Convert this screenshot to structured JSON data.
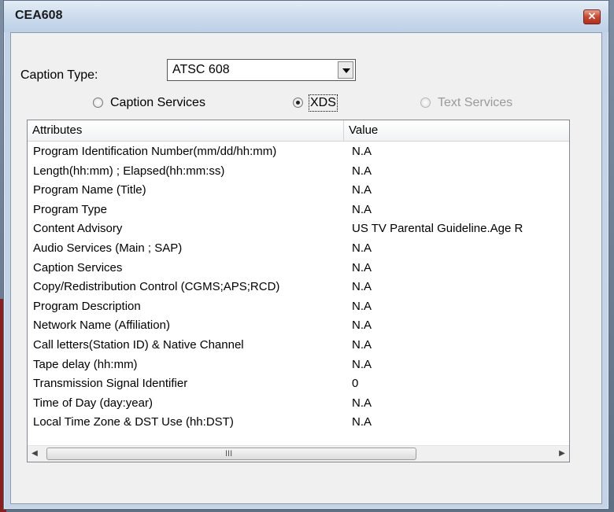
{
  "window": {
    "title": "CEA608",
    "close_glyph": "✕"
  },
  "caption_type": {
    "label": "Caption Type:",
    "selected": "ATSC 608"
  },
  "radios": [
    {
      "label": "Caption Services",
      "checked": false,
      "disabled": false
    },
    {
      "label": "XDS",
      "checked": true,
      "disabled": false
    },
    {
      "label": "Text Services",
      "checked": false,
      "disabled": true
    }
  ],
  "table": {
    "headers": [
      "Attributes",
      "Value"
    ],
    "rows": [
      [
        "Program Identification Number(mm/dd/hh:mm)",
        "N.A"
      ],
      [
        "Length(hh:mm) ; Elapsed(hh:mm:ss)",
        "N.A"
      ],
      [
        "Program Name (Title)",
        "N.A"
      ],
      [
        "Program Type",
        "N.A"
      ],
      [
        "Content Advisory",
        "US TV Parental Guideline.Age R"
      ],
      [
        "Audio Services (Main ; SAP)",
        "N.A"
      ],
      [
        "Caption Services",
        "N.A"
      ],
      [
        "Copy/Redistribution Control (CGMS;APS;RCD)",
        "N.A"
      ],
      [
        "Program Description",
        "N.A"
      ],
      [
        "Network Name (Affiliation)",
        "N.A"
      ],
      [
        "Call letters(Station ID) & Native Channel",
        "N.A"
      ],
      [
        "Tape delay (hh:mm)",
        "N.A"
      ],
      [
        "Transmission Signal Identifier",
        "0"
      ],
      [
        "Time of Day (day:year)",
        "N.A"
      ],
      [
        "Local Time Zone & DST Use (hh:DST)",
        "N.A"
      ]
    ]
  },
  "scrollbar": {
    "left_arrow": "◀",
    "right_arrow": "▶",
    "grip": "III"
  }
}
